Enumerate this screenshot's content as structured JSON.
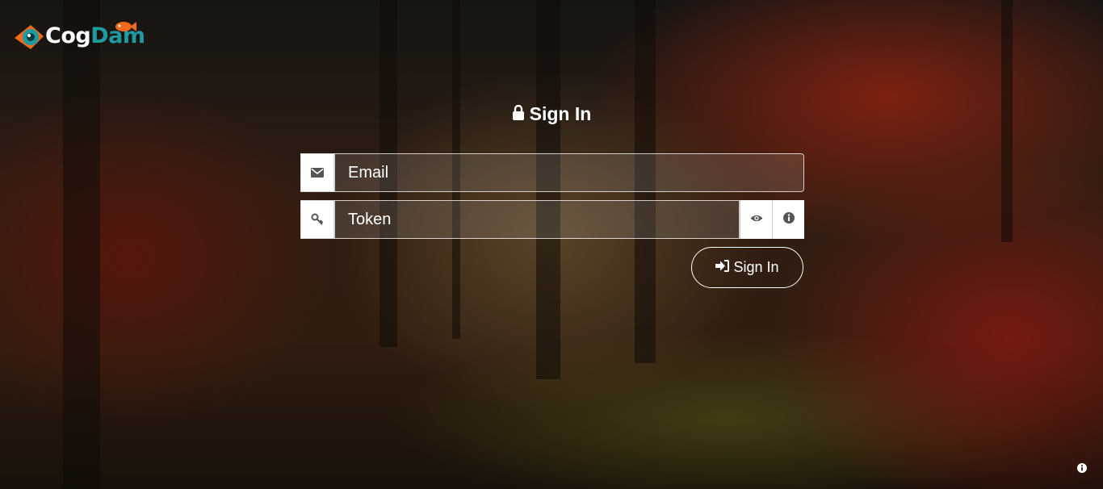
{
  "brand": {
    "part1": "Cog",
    "part2": "Dam"
  },
  "form": {
    "title": "Sign In",
    "email_placeholder": "Email",
    "token_placeholder": "Token",
    "submit_label": "Sign In"
  },
  "colors": {
    "brand_teal": "#1e9ba1",
    "brand_orange": "#f06a1d"
  },
  "icons": [
    "lock-icon",
    "envelope-icon",
    "key-icon",
    "eye-icon",
    "info-icon",
    "sign-in-icon"
  ]
}
